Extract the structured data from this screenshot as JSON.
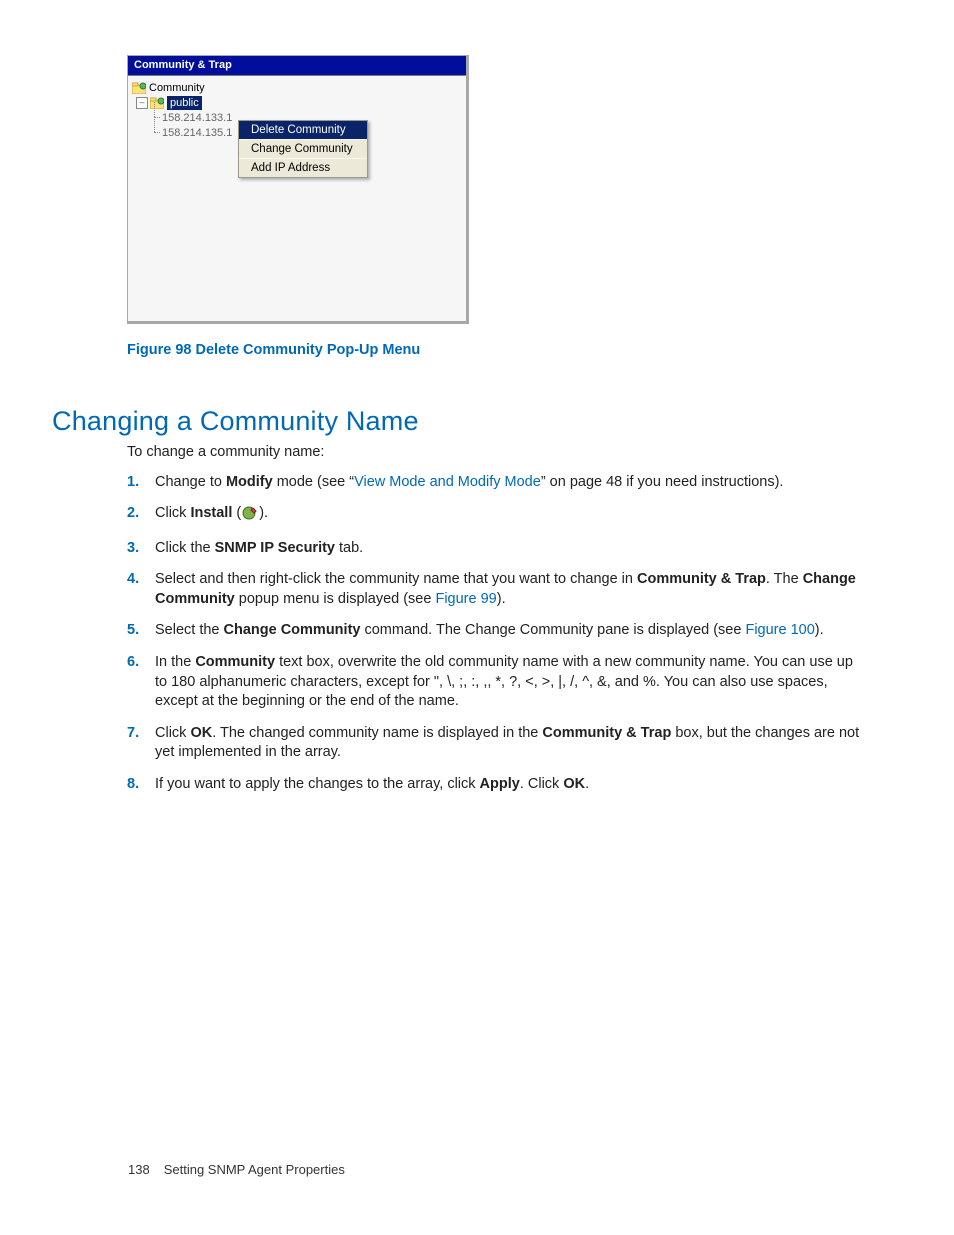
{
  "shot": {
    "header": "Community & Trap",
    "tree": {
      "root": "Community",
      "selected": "public",
      "ips": [
        "158.214.133.1",
        "158.214.135.1"
      ]
    },
    "menu": {
      "items": [
        "Delete Community",
        "Change Community",
        "Add IP Address"
      ],
      "selected_index": 0
    }
  },
  "figure_caption": "Figure 98 Delete Community Pop-Up Menu",
  "section_title": "Changing a Community Name",
  "intro": "To change a community name:",
  "steps": {
    "s1_a": "Change to ",
    "s1_b": "Modify",
    "s1_c": " mode (see “",
    "s1_link": "View Mode and Modify Mode",
    "s1_d": "” on page 48 if you need instructions).",
    "s2_a": "Click ",
    "s2_b": "Install",
    "s2_c": " (",
    "s2_d": ").",
    "s3_a": "Click the ",
    "s3_b": "SNMP IP Security",
    "s3_c": " tab.",
    "s4_a": "Select and then right-click the community name that you want to change in ",
    "s4_b": "Community & Trap",
    "s4_c": ". The ",
    "s4_d": "Change Community",
    "s4_e": " popup menu is displayed (see ",
    "s4_link": "Figure 99",
    "s4_f": ").",
    "s5_a": "Select the ",
    "s5_b": "Change Community",
    "s5_c": " command.  The Change Community pane is displayed (see ",
    "s5_link": "Figure 100",
    "s5_d": ").",
    "s6_a": "In the ",
    "s6_b": "Community",
    "s6_c": " text box, overwrite the old community name with a new community name.  You can use up to 180 alphanumeric characters, except for \", \\, ;, :, ,, *, ?, <, >, |, /, ^, &, and %. You can also use spaces, except at the beginning or the end of the name.",
    "s7_a": "Click ",
    "s7_b": "OK",
    "s7_c": ". The changed community name is displayed in the ",
    "s7_d": "Community & Trap",
    "s7_e": " box, but the changes are not yet implemented in the array.",
    "s8_a": "If you want to apply the changes to the array, click ",
    "s8_b": "Apply",
    "s8_c": ".  Click ",
    "s8_d": "OK",
    "s8_e": "."
  },
  "footer": {
    "page": "138",
    "title": "Setting SNMP Agent Properties"
  }
}
